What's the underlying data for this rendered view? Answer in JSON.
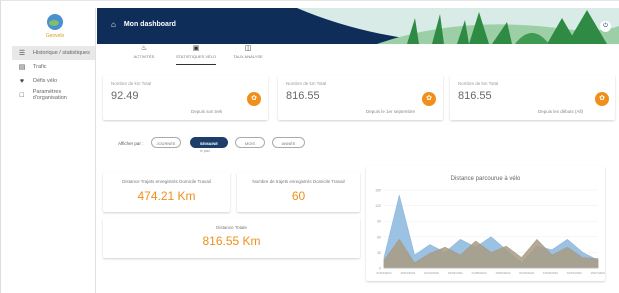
{
  "app": {
    "brand": "Geovelo",
    "header_title": "Mon dashboard"
  },
  "sidebar": {
    "items": [
      {
        "label": "Historique / statistiques",
        "icon": "list-icon",
        "active": true
      },
      {
        "label": "Trafic",
        "icon": "file-icon",
        "active": false
      },
      {
        "label": "Défis vélo",
        "icon": "trophy-icon",
        "active": false
      },
      {
        "label": "Paramètres d'organisation",
        "icon": "doc-icon",
        "active": false
      }
    ]
  },
  "tabs": [
    {
      "label": "ACTIVITÉS",
      "icon": "bike-icon",
      "active": false
    },
    {
      "label": "STATISTIQUES VÉLO",
      "icon": "stats-icon",
      "active": true
    },
    {
      "label": "TAUX ANALYSE",
      "icon": "calendar-icon",
      "active": false
    }
  ],
  "stats": [
    {
      "label": "Nombre de km Total",
      "value": "92.49",
      "sub": "Depuis son trek"
    },
    {
      "label": "Nombre de km Total",
      "value": "816.55",
      "sub": "Depuis le 1er septembre"
    },
    {
      "label": "Nombre de km Total",
      "value": "816.55",
      "sub": "Depuis les débuts (All)"
    }
  ],
  "filters": {
    "label": "Afficher par :",
    "options": [
      "JOURNÉE",
      "SEMAINE",
      "MOIS",
      "ANNÉE"
    ],
    "active": "SEMAINE",
    "note": "le plan"
  },
  "summary": {
    "a": {
      "label": "Distance Trajets enregistrés Domicile Travail",
      "value": "474.21 Km"
    },
    "b": {
      "label": "Nombre de trajets enregistrés Domicile Travail",
      "value": "60"
    },
    "total": {
      "label": "Distance Totale",
      "value": "816.55 Km"
    }
  },
  "chart_data": {
    "type": "area",
    "title": "Distance parcourue à vélo",
    "x": [
      "01/03/2022",
      "15/03/2022",
      "01/04/2022",
      "15/04/2022",
      "01/05/2022",
      "15/05/2022",
      "01/06/2022",
      "15/06/2022",
      "01/07/2022",
      "15/07/2022"
    ],
    "ylim": [
      0,
      150
    ],
    "yticks": [
      0,
      30,
      60,
      90,
      120,
      150
    ],
    "series": [
      {
        "color": "#8ab6de",
        "values": [
          20,
          140,
          25,
          45,
          30,
          55,
          40,
          60,
          35,
          10,
          42,
          35,
          55,
          30,
          15
        ]
      },
      {
        "color": "#a89b82",
        "values": [
          15,
          55,
          10,
          28,
          40,
          25,
          52,
          30,
          42,
          20,
          55,
          25,
          40,
          20,
          18
        ]
      }
    ],
    "colors": {
      "accent": "#f08f1a",
      "header": "#0f2d59"
    }
  }
}
